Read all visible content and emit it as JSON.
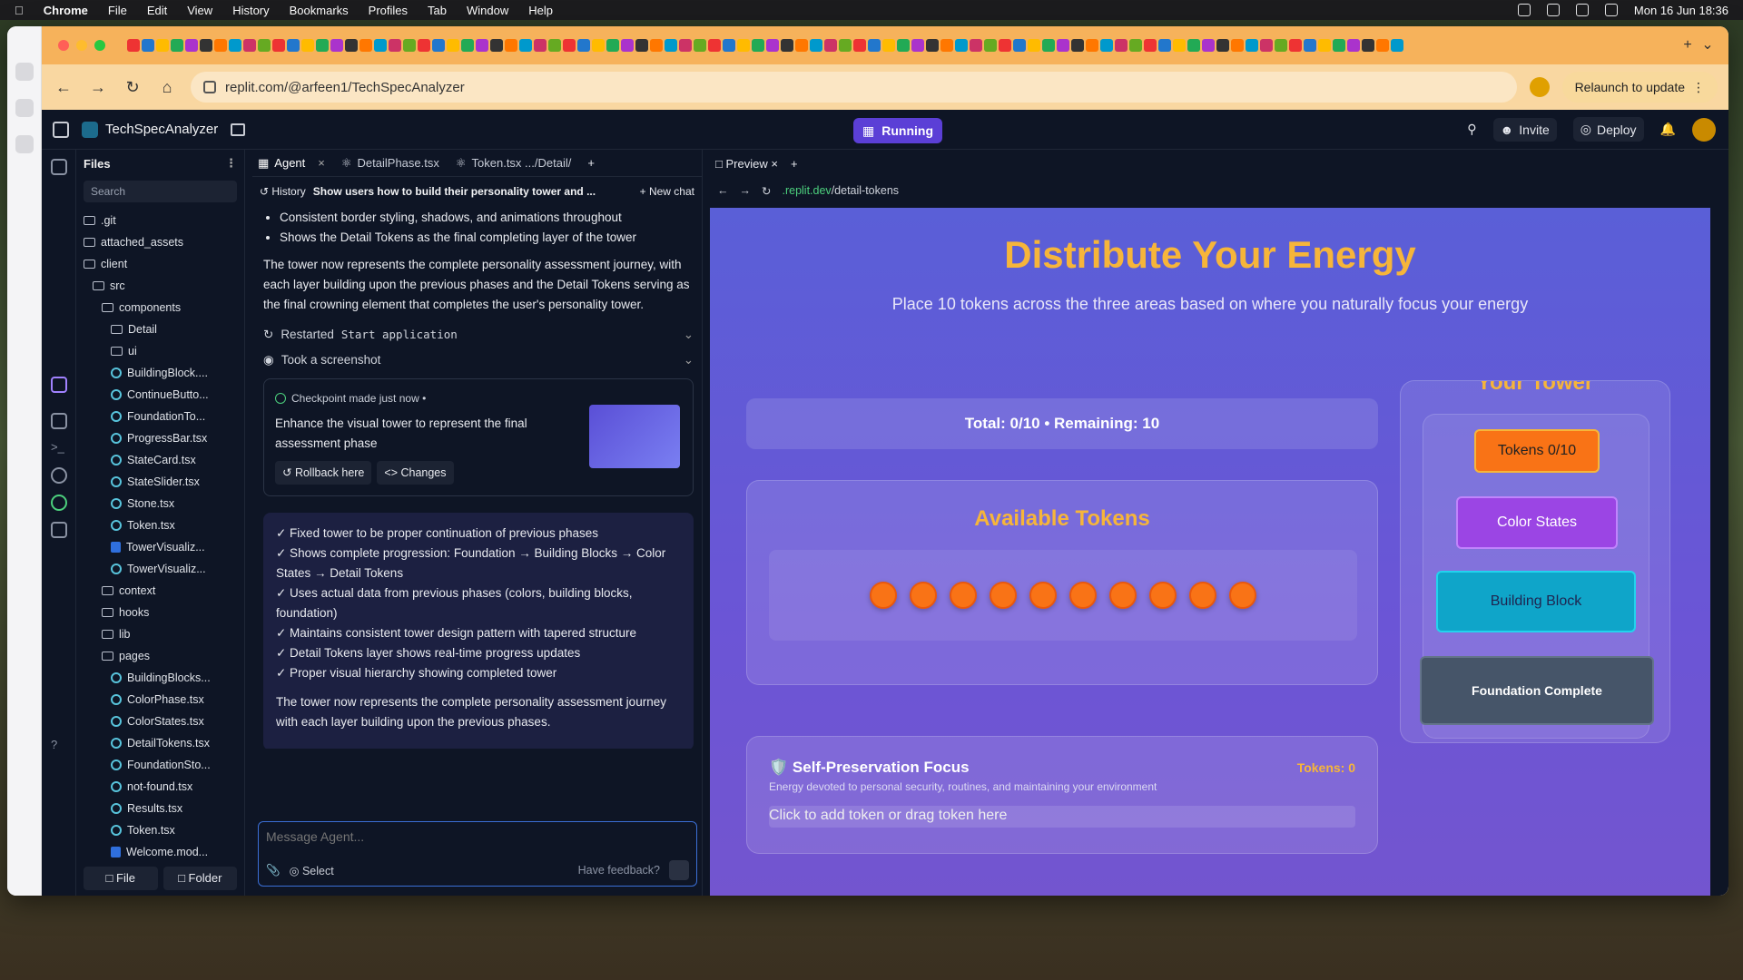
{
  "menubar": {
    "app": "Chrome",
    "items": [
      "File",
      "Edit",
      "View",
      "History",
      "Bookmarks",
      "Profiles",
      "Tab",
      "Window",
      "Help"
    ],
    "clock": "Mon 16 Jun  18:36"
  },
  "browser": {
    "url": "replit.com/@arfeen1/TechSpecAnalyzer",
    "relaunch": "Relaunch to update"
  },
  "replit": {
    "project": "TechSpecAnalyzer",
    "status": "Running",
    "invite": "Invite",
    "deploy": "Deploy",
    "files": {
      "title": "Files",
      "search": "Search",
      "file_btn": "File",
      "folder_btn": "Folder",
      "tree": [
        {
          "label": ".git",
          "kind": "folder",
          "depth": 0
        },
        {
          "label": "attached_assets",
          "kind": "folder",
          "depth": 0
        },
        {
          "label": "client",
          "kind": "folder",
          "depth": 0
        },
        {
          "label": "src",
          "kind": "folder",
          "depth": 1
        },
        {
          "label": "components",
          "kind": "folder",
          "depth": 2
        },
        {
          "label": "Detail",
          "kind": "folder",
          "depth": 3
        },
        {
          "label": "ui",
          "kind": "folder",
          "depth": 3
        },
        {
          "label": "BuildingBlock....",
          "kind": "react",
          "depth": 3
        },
        {
          "label": "ContinueButto...",
          "kind": "react",
          "depth": 3
        },
        {
          "label": "FoundationTo...",
          "kind": "react",
          "depth": 3
        },
        {
          "label": "ProgressBar.tsx",
          "kind": "react",
          "depth": 3
        },
        {
          "label": "StateCard.tsx",
          "kind": "react",
          "depth": 3
        },
        {
          "label": "StateSlider.tsx",
          "kind": "react",
          "depth": 3
        },
        {
          "label": "Stone.tsx",
          "kind": "react",
          "depth": 3
        },
        {
          "label": "Token.tsx",
          "kind": "react",
          "depth": 3
        },
        {
          "label": "TowerVisualiz...",
          "kind": "css",
          "depth": 3
        },
        {
          "label": "TowerVisualiz...",
          "kind": "react",
          "depth": 3
        },
        {
          "label": "context",
          "kind": "folder",
          "depth": 2
        },
        {
          "label": "hooks",
          "kind": "folder",
          "depth": 2
        },
        {
          "label": "lib",
          "kind": "folder",
          "depth": 2
        },
        {
          "label": "pages",
          "kind": "folder",
          "depth": 2
        },
        {
          "label": "BuildingBlocks...",
          "kind": "react",
          "depth": 3
        },
        {
          "label": "ColorPhase.tsx",
          "kind": "react",
          "depth": 3
        },
        {
          "label": "ColorStates.tsx",
          "kind": "react",
          "depth": 3
        },
        {
          "label": "DetailTokens.tsx",
          "kind": "react",
          "depth": 3
        },
        {
          "label": "FoundationSto...",
          "kind": "react",
          "depth": 3
        },
        {
          "label": "not-found.tsx",
          "kind": "react",
          "depth": 3
        },
        {
          "label": "Results.tsx",
          "kind": "react",
          "depth": 3
        },
        {
          "label": "Token.tsx",
          "kind": "react",
          "depth": 3
        },
        {
          "label": "Welcome.mod...",
          "kind": "css",
          "depth": 3
        }
      ]
    },
    "agent": {
      "tabs": [
        "Agent",
        "DetailPhase.tsx",
        "Token.tsx  .../Detail/"
      ],
      "history": "History",
      "thread": "Show users how to build their personality tower and ...",
      "new_chat": "New chat",
      "bullets": [
        "Consistent border styling, shadows, and animations throughout",
        "Shows the Detail Tokens as the final completing layer of the tower"
      ],
      "para1": "The tower now represents the complete personality assessment journey, with each layer building upon the previous phases and the Detail Tokens serving as the final crowning element that completes the user's personality tower.",
      "tool1_a": "Restarted",
      "tool1_b": "Start application",
      "tool2": "Took a screenshot",
      "checkpoint": {
        "head": "Checkpoint made just now •",
        "title": "Enhance the visual tower to represent the final assessment phase",
        "rollback": "Rollback here",
        "changes": "Changes"
      },
      "summary": [
        "✓ Fixed tower to be proper continuation of previous phases",
        "✓ Shows complete progression: Foundation → Building Blocks → Color States → Detail Tokens",
        "✓ Uses actual data from previous phases (colors, building blocks, foundation)",
        "✓ Maintains consistent tower design pattern with tapered structure",
        "✓ Detail Tokens layer shows real-time progress updates",
        "✓ Proper visual hierarchy showing completed tower"
      ],
      "summary_end": "The tower now represents the complete personality assessment journey with each layer building upon the previous phases.",
      "composer_placeholder": "Message Agent...",
      "select": "Select",
      "feedback": "Have feedback?"
    },
    "preview": {
      "tab": "Preview",
      "url_a": ".replit.dev",
      "url_b": "/detail-tokens"
    }
  },
  "page": {
    "title": "Distribute Your Energy",
    "subtitle": "Place 10 tokens across the three areas based on where you naturally focus your energy",
    "totals": "Total: 0/10 • Remaining: 10",
    "available": "Available Tokens",
    "token_count": 10,
    "focus": {
      "icon": "🛡️",
      "title": "Self-Preservation Focus",
      "tokens": "Tokens: 0",
      "desc": "Energy devoted to personal security, routines, and maintaining your environment",
      "drop": "Click to add token or drag token here"
    },
    "tower": {
      "title": "Your Tower",
      "layers": [
        "Tokens 0/10",
        "Color States",
        "Building Block",
        "Foundation Complete"
      ]
    },
    "colors": {
      "accent": "#f6b53a",
      "token": "#f97316",
      "running": "#5b3fd6"
    }
  }
}
